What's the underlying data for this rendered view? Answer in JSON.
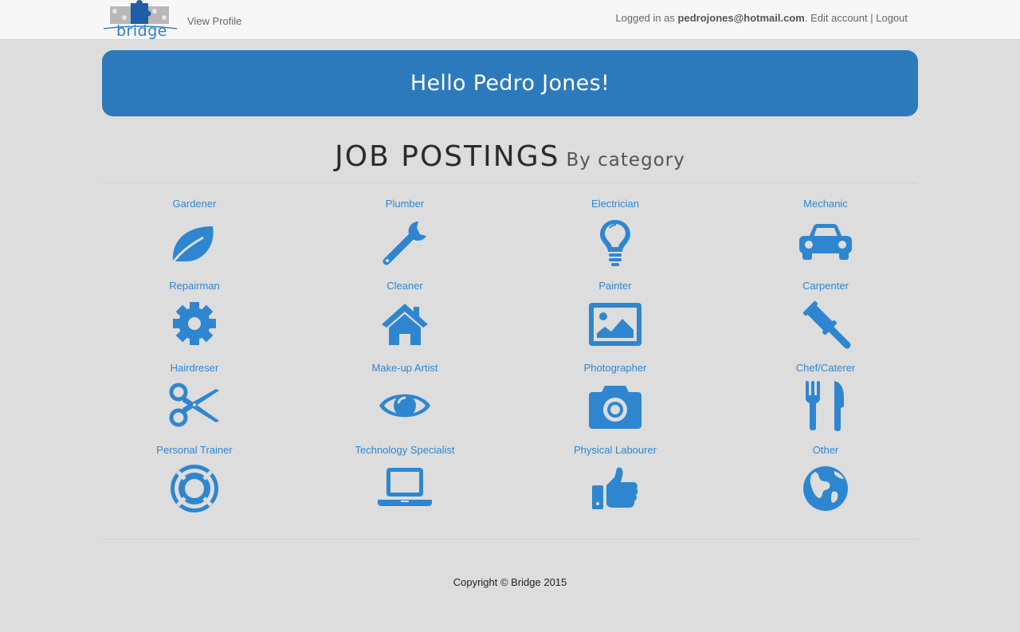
{
  "nav": {
    "logo_text": "bridge",
    "view_profile": "View Profile",
    "logged_in_prefix": "Logged in as ",
    "user_email": "pedrojones@hotmail.com",
    "period": ". ",
    "edit_account": "Edit account",
    "separator": " | ",
    "logout": "Logout"
  },
  "banner": {
    "greeting": "Hello Pedro Jones!"
  },
  "section": {
    "title": "JOB POSTINGS",
    "subtitle": "By category"
  },
  "categories": [
    {
      "label": "Gardener",
      "icon": "leaf-icon"
    },
    {
      "label": "Plumber",
      "icon": "wrench-icon"
    },
    {
      "label": "Electrician",
      "icon": "lightbulb-icon"
    },
    {
      "label": "Mechanic",
      "icon": "car-icon"
    },
    {
      "label": "Repairman",
      "icon": "gear-icon"
    },
    {
      "label": "Cleaner",
      "icon": "house-icon"
    },
    {
      "label": "Painter",
      "icon": "picture-icon"
    },
    {
      "label": "Carpenter",
      "icon": "gavel-icon"
    },
    {
      "label": "Hairdreser",
      "icon": "scissors-icon"
    },
    {
      "label": "Make-up Artist",
      "icon": "eye-icon"
    },
    {
      "label": "Photographer",
      "icon": "camera-icon"
    },
    {
      "label": "Chef/Caterer",
      "icon": "cutlery-icon"
    },
    {
      "label": "Personal Trainer",
      "icon": "lifebuoy-icon"
    },
    {
      "label": "Technology Specialist",
      "icon": "laptop-icon"
    },
    {
      "label": "Physical Labourer",
      "icon": "thumbs-up-icon"
    },
    {
      "label": "Other",
      "icon": "globe-icon"
    }
  ],
  "footer": {
    "copyright": "Copyright © Bridge 2015"
  },
  "colors": {
    "accent": "#2f86d0",
    "banner": "#2c7abb",
    "background": "#dddddd",
    "navbar": "#f7f7f7"
  }
}
